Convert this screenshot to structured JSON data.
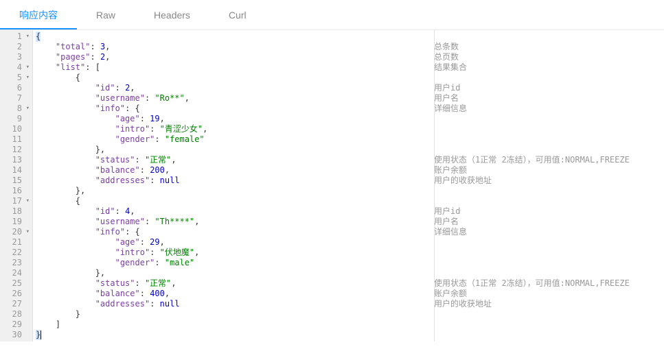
{
  "tabs": [
    {
      "label": "响应内容",
      "active": true
    },
    {
      "label": "Raw",
      "active": false
    },
    {
      "label": "Headers",
      "active": false
    },
    {
      "label": "Curl",
      "active": false
    }
  ],
  "lines": [
    {
      "n": "1",
      "fold": "▾",
      "code": [
        [
          "p",
          "{"
        ]
      ],
      "c": "",
      "sel": true
    },
    {
      "n": "2",
      "fold": "",
      "code": [
        [
          "p",
          "    "
        ],
        [
          "k",
          "\"total\""
        ],
        [
          "p",
          ": "
        ],
        [
          "n",
          "3"
        ],
        [
          "p",
          ","
        ]
      ],
      "c": "总条数"
    },
    {
      "n": "3",
      "fold": "",
      "code": [
        [
          "p",
          "    "
        ],
        [
          "k",
          "\"pages\""
        ],
        [
          "p",
          ": "
        ],
        [
          "n",
          "2"
        ],
        [
          "p",
          ","
        ]
      ],
      "c": "总页数"
    },
    {
      "n": "4",
      "fold": "▾",
      "code": [
        [
          "p",
          "    "
        ],
        [
          "k",
          "\"list\""
        ],
        [
          "p",
          ": ["
        ]
      ],
      "c": "结果集合"
    },
    {
      "n": "5",
      "fold": "▾",
      "code": [
        [
          "p",
          "        {"
        ]
      ],
      "c": ""
    },
    {
      "n": "6",
      "fold": "",
      "code": [
        [
          "p",
          "            "
        ],
        [
          "k",
          "\"id\""
        ],
        [
          "p",
          ": "
        ],
        [
          "n",
          "2"
        ],
        [
          "p",
          ","
        ]
      ],
      "c": "用户id"
    },
    {
      "n": "7",
      "fold": "",
      "code": [
        [
          "p",
          "            "
        ],
        [
          "k",
          "\"username\""
        ],
        [
          "p",
          ": "
        ],
        [
          "s",
          "\"Ro**\""
        ],
        [
          "p",
          ","
        ]
      ],
      "c": "用户名"
    },
    {
      "n": "8",
      "fold": "▾",
      "code": [
        [
          "p",
          "            "
        ],
        [
          "k",
          "\"info\""
        ],
        [
          "p",
          ": {"
        ]
      ],
      "c": "详细信息"
    },
    {
      "n": "9",
      "fold": "",
      "code": [
        [
          "p",
          "                "
        ],
        [
          "k",
          "\"age\""
        ],
        [
          "p",
          ": "
        ],
        [
          "n",
          "19"
        ],
        [
          "p",
          ","
        ]
      ],
      "c": ""
    },
    {
      "n": "10",
      "fold": "",
      "code": [
        [
          "p",
          "                "
        ],
        [
          "k",
          "\"intro\""
        ],
        [
          "p",
          ": "
        ],
        [
          "s",
          "\"青涩少女\""
        ],
        [
          "p",
          ","
        ]
      ],
      "c": ""
    },
    {
      "n": "11",
      "fold": "",
      "code": [
        [
          "p",
          "                "
        ],
        [
          "k",
          "\"gender\""
        ],
        [
          "p",
          ": "
        ],
        [
          "s",
          "\"female\""
        ]
      ],
      "c": ""
    },
    {
      "n": "12",
      "fold": "",
      "code": [
        [
          "p",
          "            },"
        ]
      ],
      "c": ""
    },
    {
      "n": "13",
      "fold": "",
      "code": [
        [
          "p",
          "            "
        ],
        [
          "k",
          "\"status\""
        ],
        [
          "p",
          ": "
        ],
        [
          "s",
          "\"正常\""
        ],
        [
          "p",
          ","
        ]
      ],
      "c": "使用状态（1正常 2冻结），可用值:NORMAL,FREEZE"
    },
    {
      "n": "14",
      "fold": "",
      "code": [
        [
          "p",
          "            "
        ],
        [
          "k",
          "\"balance\""
        ],
        [
          "p",
          ": "
        ],
        [
          "n",
          "200"
        ],
        [
          "p",
          ","
        ]
      ],
      "c": "账户余额"
    },
    {
      "n": "15",
      "fold": "",
      "code": [
        [
          "p",
          "            "
        ],
        [
          "k",
          "\"addresses\""
        ],
        [
          "p",
          ": "
        ],
        [
          "n",
          "null"
        ]
      ],
      "c": "用户的收获地址"
    },
    {
      "n": "16",
      "fold": "",
      "code": [
        [
          "p",
          "        },"
        ]
      ],
      "c": ""
    },
    {
      "n": "17",
      "fold": "▾",
      "code": [
        [
          "p",
          "        {"
        ]
      ],
      "c": ""
    },
    {
      "n": "18",
      "fold": "",
      "code": [
        [
          "p",
          "            "
        ],
        [
          "k",
          "\"id\""
        ],
        [
          "p",
          ": "
        ],
        [
          "n",
          "4"
        ],
        [
          "p",
          ","
        ]
      ],
      "c": "用户id"
    },
    {
      "n": "19",
      "fold": "",
      "code": [
        [
          "p",
          "            "
        ],
        [
          "k",
          "\"username\""
        ],
        [
          "p",
          ": "
        ],
        [
          "s",
          "\"Th****\""
        ],
        [
          "p",
          ","
        ]
      ],
      "c": "用户名"
    },
    {
      "n": "20",
      "fold": "▾",
      "code": [
        [
          "p",
          "            "
        ],
        [
          "k",
          "\"info\""
        ],
        [
          "p",
          ": {"
        ]
      ],
      "c": "详细信息"
    },
    {
      "n": "21",
      "fold": "",
      "code": [
        [
          "p",
          "                "
        ],
        [
          "k",
          "\"age\""
        ],
        [
          "p",
          ": "
        ],
        [
          "n",
          "29"
        ],
        [
          "p",
          ","
        ]
      ],
      "c": ""
    },
    {
      "n": "22",
      "fold": "",
      "code": [
        [
          "p",
          "                "
        ],
        [
          "k",
          "\"intro\""
        ],
        [
          "p",
          ": "
        ],
        [
          "s",
          "\"伏地魔\""
        ],
        [
          "p",
          ","
        ]
      ],
      "c": ""
    },
    {
      "n": "23",
      "fold": "",
      "code": [
        [
          "p",
          "                "
        ],
        [
          "k",
          "\"gender\""
        ],
        [
          "p",
          ": "
        ],
        [
          "s",
          "\"male\""
        ]
      ],
      "c": ""
    },
    {
      "n": "24",
      "fold": "",
      "code": [
        [
          "p",
          "            },"
        ]
      ],
      "c": ""
    },
    {
      "n": "25",
      "fold": "",
      "code": [
        [
          "p",
          "            "
        ],
        [
          "k",
          "\"status\""
        ],
        [
          "p",
          ": "
        ],
        [
          "s",
          "\"正常\""
        ],
        [
          "p",
          ","
        ]
      ],
      "c": "使用状态（1正常 2冻结），可用值:NORMAL,FREEZE"
    },
    {
      "n": "26",
      "fold": "",
      "code": [
        [
          "p",
          "            "
        ],
        [
          "k",
          "\"balance\""
        ],
        [
          "p",
          ": "
        ],
        [
          "n",
          "400"
        ],
        [
          "p",
          ","
        ]
      ],
      "c": "账户余额"
    },
    {
      "n": "27",
      "fold": "",
      "code": [
        [
          "p",
          "            "
        ],
        [
          "k",
          "\"addresses\""
        ],
        [
          "p",
          ": "
        ],
        [
          "n",
          "null"
        ]
      ],
      "c": "用户的收获地址"
    },
    {
      "n": "28",
      "fold": "",
      "code": [
        [
          "p",
          "        }"
        ]
      ],
      "c": ""
    },
    {
      "n": "29",
      "fold": "",
      "code": [
        [
          "p",
          "    ]"
        ]
      ],
      "c": ""
    },
    {
      "n": "30",
      "fold": "",
      "code": [
        [
          "p",
          "}"
        ]
      ],
      "c": "",
      "sel": true,
      "cursor": true
    }
  ]
}
